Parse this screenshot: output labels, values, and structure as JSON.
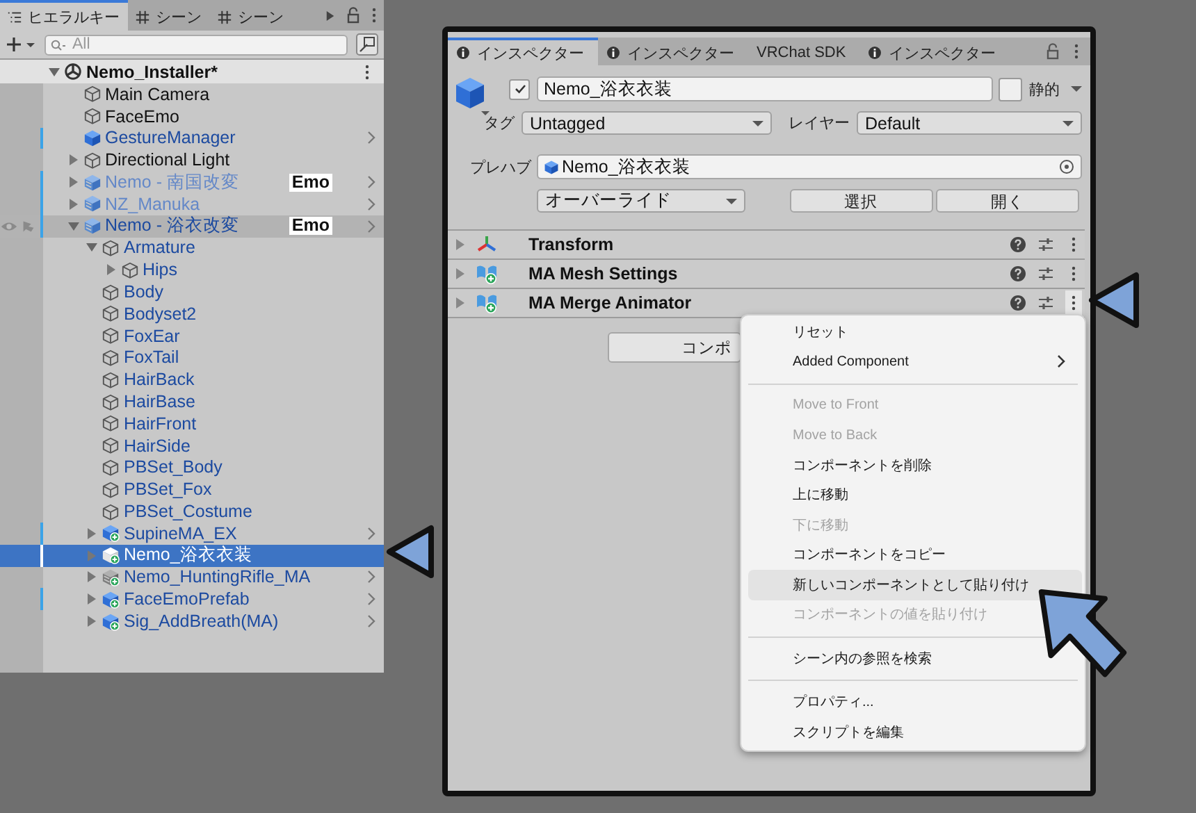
{
  "hierarchy": {
    "tabs": [
      {
        "label": "ヒエラルキー",
        "selected": true
      },
      {
        "label": "シーン",
        "selected": false
      },
      {
        "label": "シーン",
        "selected": false
      }
    ],
    "search": {
      "placeholder": "All"
    },
    "scene": {
      "name": "Nemo_Installer*",
      "expanded": true,
      "children": [
        {
          "name": "Main Camera",
          "kind": "object",
          "prefab": false,
          "missing": false,
          "marker": false,
          "chevron": false,
          "hovered": false,
          "selected": false
        },
        {
          "name": "FaceEmo",
          "kind": "object",
          "prefab": false,
          "missing": false,
          "marker": false,
          "chevron": false,
          "hovered": false,
          "selected": false
        },
        {
          "name": "GestureManager",
          "kind": "prefab",
          "prefab": true,
          "missing": false,
          "marker": true,
          "chevron": true,
          "hovered": false,
          "selected": false
        },
        {
          "name": "Directional Light",
          "kind": "object",
          "prefab": false,
          "missing": false,
          "expanded": false,
          "marker": false,
          "chevron": false,
          "hovered": false,
          "selected": false
        },
        {
          "name": "Nemo - 南国改変",
          "kind": "variant",
          "prefab": true,
          "missing": true,
          "expanded": false,
          "badge": "Emo",
          "marker": true,
          "chevron": true,
          "hovered": false,
          "selected": false
        },
        {
          "name": "NZ_Manuka",
          "kind": "variant",
          "prefab": true,
          "missing": true,
          "expanded": false,
          "marker": true,
          "chevron": true,
          "hovered": false,
          "selected": false
        },
        {
          "name": "Nemo - 浴衣改変",
          "kind": "variant",
          "prefab": true,
          "missing": false,
          "expanded": true,
          "badge": "Emo",
          "marker": true,
          "chevron": true,
          "hovered": true,
          "selected": false,
          "children": [
            {
              "name": "Armature",
              "kind": "object",
              "prefab": true,
              "missing": false,
              "expanded": true,
              "marker": false,
              "chevron": false,
              "hovered": false,
              "selected": false,
              "children": [
                {
                  "name": "Hips",
                  "kind": "object",
                  "prefab": true,
                  "missing": false,
                  "expanded": false,
                  "marker": false,
                  "chevron": false,
                  "hovered": false,
                  "selected": false
                }
              ]
            },
            {
              "name": "Body",
              "kind": "object",
              "prefab": true,
              "missing": false,
              "marker": false,
              "chevron": false,
              "hovered": false,
              "selected": false
            },
            {
              "name": "Bodyset2",
              "kind": "object",
              "prefab": true,
              "missing": false,
              "marker": false,
              "chevron": false,
              "hovered": false,
              "selected": false
            },
            {
              "name": "FoxEar",
              "kind": "object",
              "prefab": true,
              "missing": false,
              "marker": false,
              "chevron": false,
              "hovered": false,
              "selected": false
            },
            {
              "name": "FoxTail",
              "kind": "object",
              "prefab": true,
              "missing": false,
              "marker": false,
              "chevron": false,
              "hovered": false,
              "selected": false
            },
            {
              "name": "HairBack",
              "kind": "object",
              "prefab": true,
              "missing": false,
              "marker": false,
              "chevron": false,
              "hovered": false,
              "selected": false
            },
            {
              "name": "HairBase",
              "kind": "object",
              "prefab": true,
              "missing": false,
              "marker": false,
              "chevron": false,
              "hovered": false,
              "selected": false
            },
            {
              "name": "HairFront",
              "kind": "object",
              "prefab": true,
              "missing": false,
              "marker": false,
              "chevron": false,
              "hovered": false,
              "selected": false
            },
            {
              "name": "HairSide",
              "kind": "object",
              "prefab": true,
              "missing": false,
              "marker": false,
              "chevron": false,
              "hovered": false,
              "selected": false
            },
            {
              "name": "PBSet_Body",
              "kind": "object",
              "prefab": true,
              "missing": false,
              "marker": false,
              "chevron": false,
              "hovered": false,
              "selected": false
            },
            {
              "name": "PBSet_Fox",
              "kind": "object",
              "prefab": true,
              "missing": false,
              "marker": false,
              "chevron": false,
              "hovered": false,
              "selected": false
            },
            {
              "name": "PBSet_Costume",
              "kind": "object",
              "prefab": true,
              "missing": false,
              "marker": false,
              "chevron": false,
              "hovered": false,
              "selected": false
            },
            {
              "name": "SupineMA_EX",
              "kind": "ma-prefab",
              "prefab": true,
              "missing": false,
              "expanded": false,
              "marker": true,
              "chevron": true,
              "hovered": false,
              "selected": false
            },
            {
              "name": "Nemo_浴衣衣装",
              "kind": "ma-prefab",
              "prefab": true,
              "missing": false,
              "expanded": false,
              "marker": true,
              "chevron": false,
              "hovered": false,
              "selected": true
            },
            {
              "name": "Nemo_HuntingRifle_MA",
              "kind": "ma-variant",
              "prefab": true,
              "missing": false,
              "expanded": false,
              "marker": false,
              "chevron": true,
              "hovered": false,
              "selected": false
            },
            {
              "name": "FaceEmoPrefab",
              "kind": "ma-prefab",
              "prefab": true,
              "missing": false,
              "expanded": false,
              "marker": true,
              "chevron": true,
              "hovered": false,
              "selected": false
            },
            {
              "name": "Sig_AddBreath(MA)",
              "kind": "ma-prefab",
              "prefab": true,
              "missing": false,
              "expanded": false,
              "marker": false,
              "chevron": true,
              "hovered": false,
              "selected": false
            }
          ]
        }
      ]
    }
  },
  "inspector": {
    "tabs": [
      {
        "label": "インスペクター",
        "icon": true,
        "selected": true
      },
      {
        "label": "インスペクター",
        "icon": true,
        "selected": false
      },
      {
        "label": "VRChat SDK",
        "icon": false,
        "selected": false
      },
      {
        "label": "インスペクター",
        "icon": true,
        "selected": false
      }
    ],
    "object": {
      "active": true,
      "name": "Nemo_浴衣衣装",
      "static": false,
      "static_label": "静的",
      "tag_label": "タグ",
      "tag": "Untagged",
      "layer_label": "レイヤー",
      "layer": "Default"
    },
    "prefab": {
      "label": "プレハブ",
      "asset": "Nemo_浴衣衣装",
      "overrides": "オーバーライド",
      "buttons": [
        "選択",
        "開く"
      ]
    },
    "components": [
      {
        "name": "Transform",
        "kind": "transform",
        "expanded": false,
        "menu_open": false
      },
      {
        "name": "MA Mesh Settings",
        "kind": "ma",
        "expanded": false,
        "menu_open": false
      },
      {
        "name": "MA Merge Animator",
        "kind": "ma",
        "expanded": false,
        "menu_open": true
      }
    ],
    "add_button": "コンポ"
  },
  "context_menu": {
    "items": [
      {
        "kind": "item",
        "label": "リセット",
        "disabled": false,
        "hovered": false
      },
      {
        "kind": "submenu",
        "label": "Added Component",
        "disabled": false,
        "hovered": false
      },
      {
        "kind": "separator"
      },
      {
        "kind": "item",
        "label": "Move to Front",
        "disabled": true,
        "hovered": false
      },
      {
        "kind": "item",
        "label": "Move to Back",
        "disabled": true,
        "hovered": false
      },
      {
        "kind": "item",
        "label": "コンポーネントを削除",
        "disabled": false,
        "hovered": false
      },
      {
        "kind": "item",
        "label": "上に移動",
        "disabled": false,
        "hovered": false
      },
      {
        "kind": "item",
        "label": "下に移動",
        "disabled": true,
        "hovered": false
      },
      {
        "kind": "item",
        "label": "コンポーネントをコピー",
        "disabled": false,
        "hovered": false
      },
      {
        "kind": "item",
        "label": "新しいコンポーネントとして貼り付け",
        "disabled": false,
        "hovered": true
      },
      {
        "kind": "item",
        "label": "コンポーネントの値を貼り付け",
        "disabled": true,
        "hovered": false
      },
      {
        "kind": "separator"
      },
      {
        "kind": "item",
        "label": "シーン内の参照を検索",
        "disabled": false,
        "hovered": false
      },
      {
        "kind": "separator"
      },
      {
        "kind": "item",
        "label": "プロパティ...",
        "disabled": false,
        "hovered": false
      },
      {
        "kind": "item",
        "label": "スクリプトを編集",
        "disabled": false,
        "hovered": false
      }
    ]
  }
}
